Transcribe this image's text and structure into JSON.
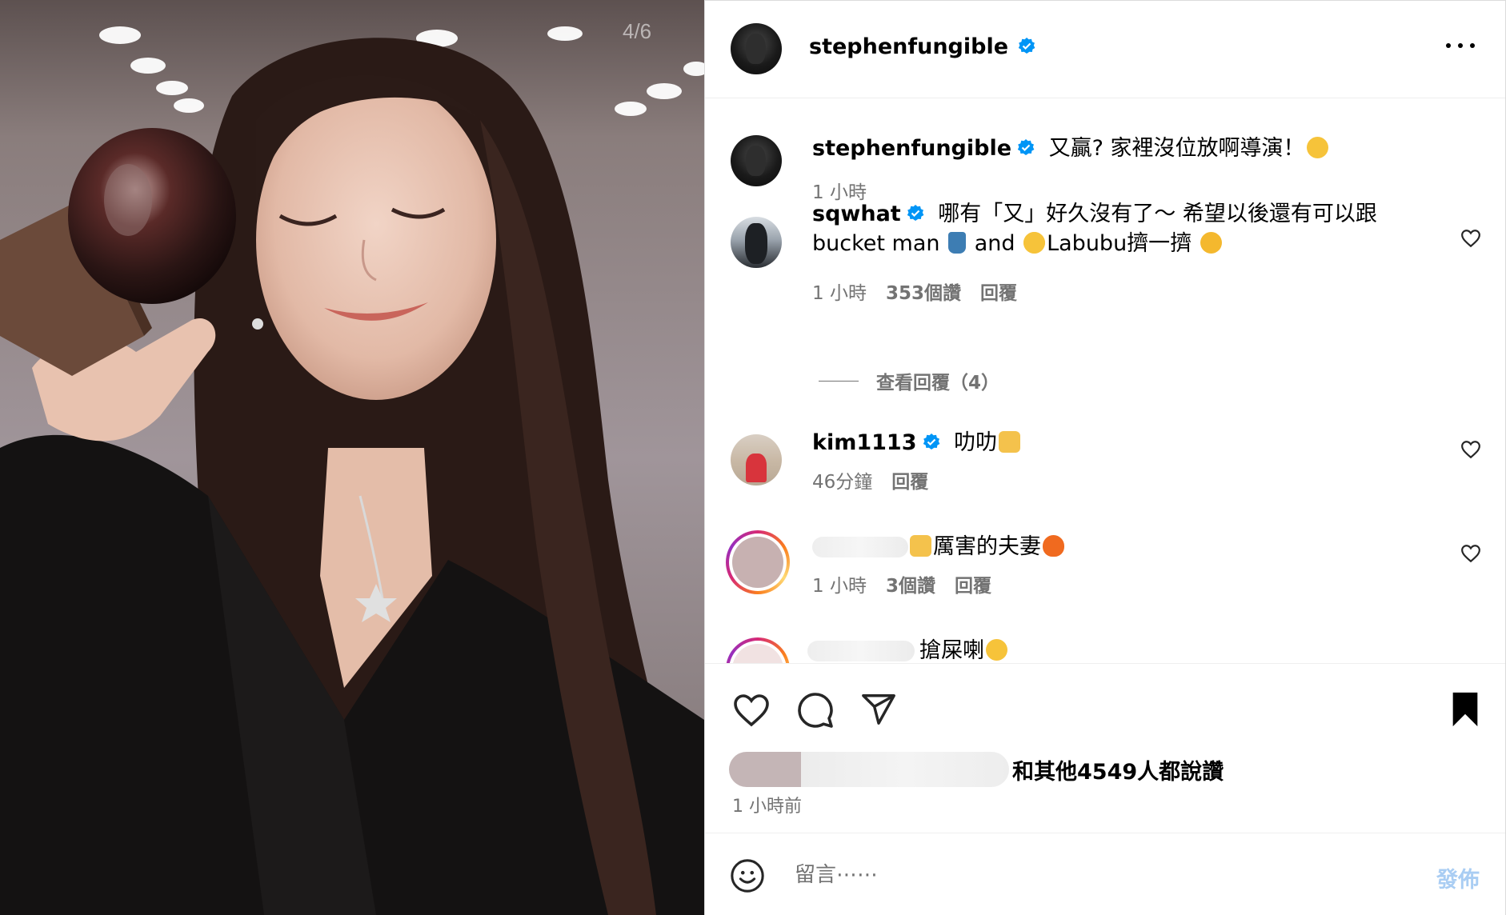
{
  "photo": {
    "counter": "4/6"
  },
  "post": {
    "author": "stephenfungible",
    "more_icon": "more-horizontal-icon"
  },
  "caption": {
    "username": "stephenfungible",
    "text": "又贏? 家裡沒位放啊導演！",
    "time": "1 小時"
  },
  "comments": [
    {
      "username": "sqwhat",
      "text_part1": "哪有「又」好久沒有了～ 希望以後還有可以跟",
      "text_part2a": "bucket man",
      "text_part2b": "and",
      "text_part2c": "Labubu擠一擠",
      "time": "1 小時",
      "likes": "353個讚",
      "reply": "回覆",
      "view_replies": "查看回覆（4）"
    },
    {
      "username": "kim1113",
      "text": "叻叻",
      "time": "46分鐘",
      "reply": "回覆"
    },
    {
      "text": "厲害的夫妻",
      "time": "1 小時",
      "likes": "3個讚",
      "reply": "回覆"
    },
    {
      "text": "搶屎喇"
    }
  ],
  "likes_summary": "和其他4549人都說讚",
  "posted_time": "1 小時前",
  "add_comment": {
    "placeholder": "留言⋯⋯",
    "post_label": "發佈"
  },
  "colors": {
    "verified": "#0095f6",
    "post_btn_disabled": "#a9cdf3",
    "meta": "#737373"
  }
}
